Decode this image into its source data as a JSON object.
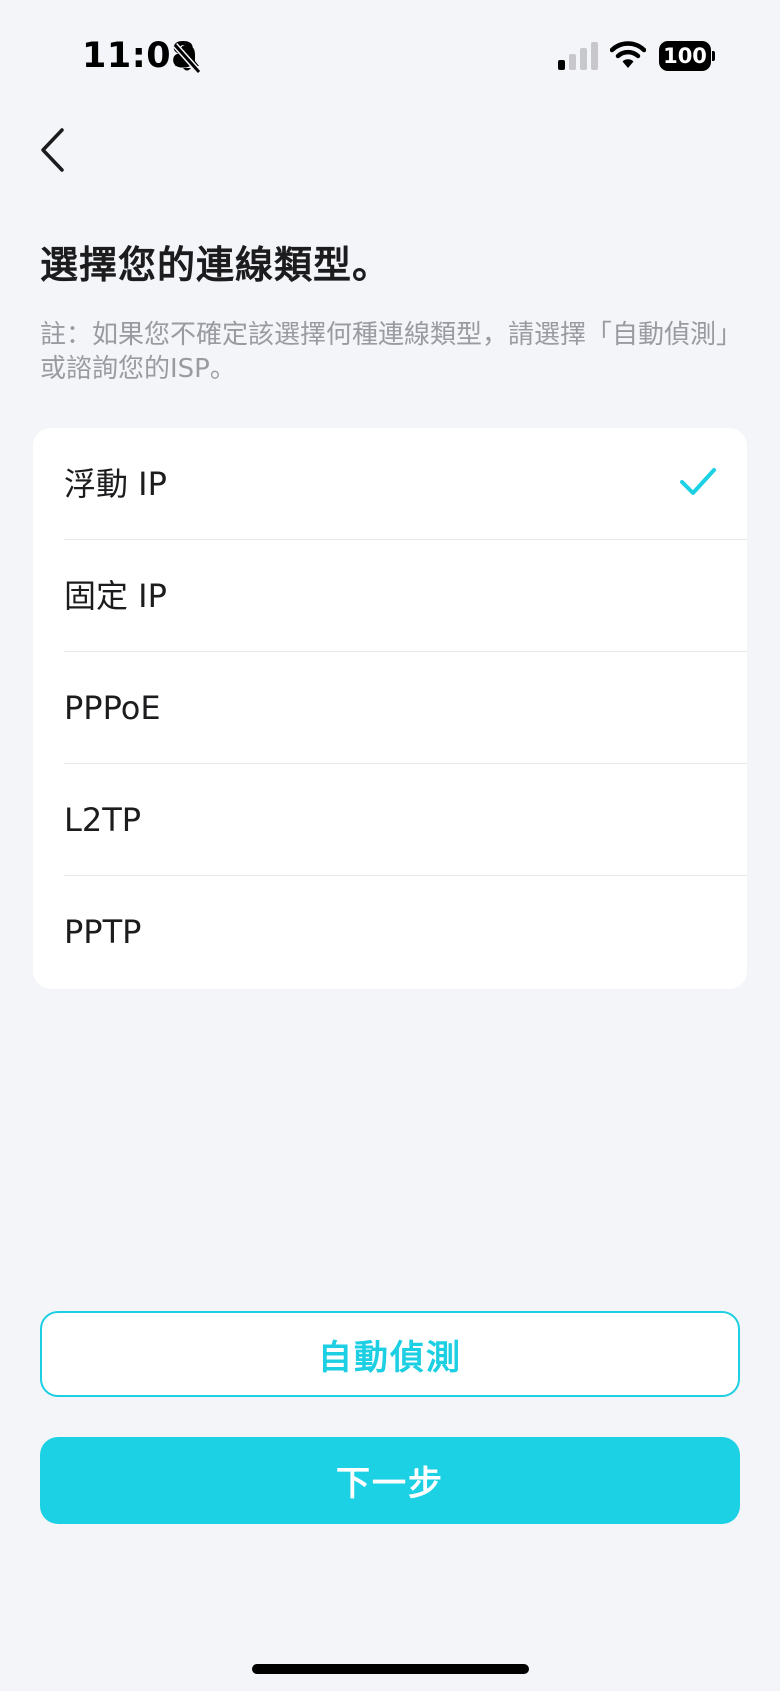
{
  "status_bar": {
    "time": "11:08",
    "battery": "100",
    "icons": [
      "bell-off-icon",
      "cellular-signal-icon",
      "wifi-icon",
      "battery-icon"
    ]
  },
  "nav": {
    "back_icon": "chevron-left-icon"
  },
  "title": "選擇您的連線類型。",
  "note": "註：如果您不確定該選擇何種連線類型，請選擇「自動偵測」或諮詢您的ISP。",
  "options": [
    {
      "label": "浮動 IP",
      "selected": true
    },
    {
      "label": "固定 IP",
      "selected": false
    },
    {
      "label": "PPPoE",
      "selected": false
    },
    {
      "label": "L2TP",
      "selected": false
    },
    {
      "label": "PPTP",
      "selected": false
    }
  ],
  "buttons": {
    "auto_detect": "自動偵測",
    "next": "下一步"
  },
  "colors": {
    "accent": "#1dd1e5",
    "background": "#f4f5f9",
    "card": "#ffffff",
    "note_text": "#9a9ba1"
  }
}
